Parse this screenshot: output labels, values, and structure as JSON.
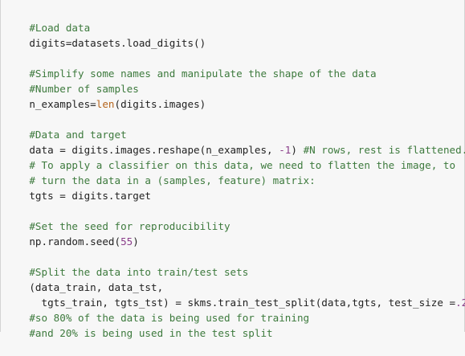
{
  "colors": {
    "background": "#f7f7f7",
    "comment": "#3d7a3d",
    "default_text": "#222222",
    "builtin": "#b5651d",
    "number": "#8a3d8a"
  },
  "code": {
    "line_01": "#Load data",
    "line_02": "digits=datasets.load_digits()",
    "line_04": "#Simplify some names and manipulate the shape of the data",
    "line_05": "#Number of samples",
    "line_06a": "n_examples=",
    "line_06b": "len",
    "line_06c": "(digits.images)",
    "line_08": "#Data and target",
    "line_09a": "data = digits.images.reshape(n_examples, ",
    "line_09b": "-1",
    "line_09c": ") ",
    "line_09d": "#N rows, rest is flattened.",
    "line_10": "# To apply a classifier on this data, we need to flatten the image, to",
    "line_11": "# turn the data in a (samples, feature) matrix:",
    "line_12": "tgts = digits.target",
    "line_14": "#Set the seed for reproducibility",
    "line_15a": "np.random.seed(",
    "line_15b": "55",
    "line_15c": ")",
    "line_17": "#Split the data into train/test sets",
    "line_18": "(data_train, data_tst,",
    "line_19a": "  tgts_train, tgts_tst) = skms.train_test_split(data,tgts, test_size =",
    "line_19b": ".2",
    "line_19c": ")",
    "line_20": "#so 80% of the data is being used for training",
    "line_21": "#and 20% is being used in the test split"
  }
}
